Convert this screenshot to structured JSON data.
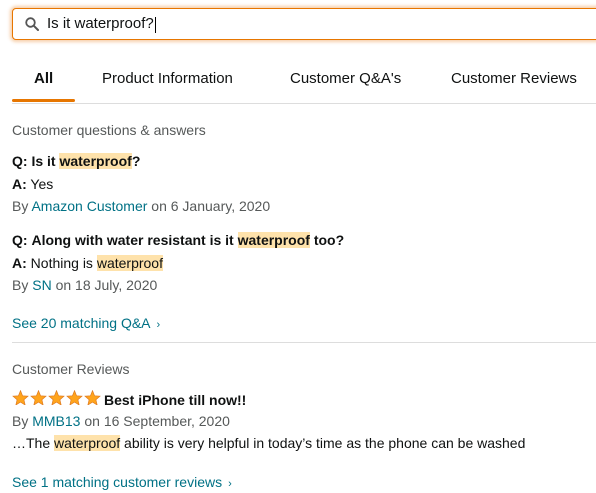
{
  "search": {
    "query": "Is it waterproof?"
  },
  "tabs": [
    {
      "label": "All"
    },
    {
      "label": "Product Information"
    },
    {
      "label": "Customer Q&A's"
    },
    {
      "label": "Customer Reviews"
    }
  ],
  "qa_section": {
    "title": "Customer questions & answers",
    "items": [
      {
        "q_prefix": "Q:",
        "q_pre": "Is it ",
        "q_hl": "waterproof",
        "q_post": "?",
        "a_prefix": "A:",
        "a_pre": "Yes",
        "a_hl": "",
        "by": "By",
        "author": "Amazon Customer",
        "date": "on 6 January, 2020"
      },
      {
        "q_prefix": "Q:",
        "q_pre": "Along with water resistant is it ",
        "q_hl": "waterproof",
        "q_post": " too?",
        "a_prefix": "A:",
        "a_pre": "Nothing is ",
        "a_hl": "waterproof",
        "by": "By",
        "author": "SN",
        "date": "on 18 July, 2020"
      }
    ],
    "see_more": "See 20 matching Q&A"
  },
  "reviews_section": {
    "title": "Customer Reviews",
    "rating": 5,
    "star_color": "#ffa41c",
    "review_title": "Best iPhone till now!!",
    "by": "By",
    "author": "MMB13",
    "date": "on 16 September, 2020",
    "snippet_pre": "…The ",
    "snippet_hl": "waterproof",
    "snippet_post": " ability is very helpful in today’s time as the phone can be washed",
    "see_more": "See 1 matching customer reviews"
  },
  "colors": {
    "accent": "#e77600",
    "link": "#007185",
    "highlight": "#fee2ab"
  }
}
